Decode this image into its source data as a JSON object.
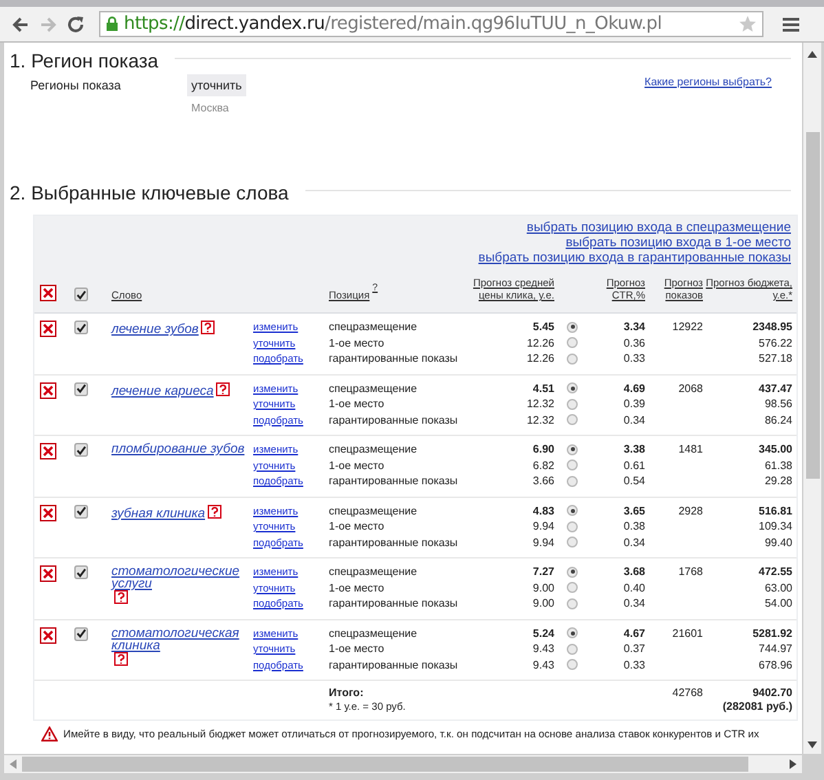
{
  "browser": {
    "url_scheme": "https://",
    "url_host": "direct.yandex.ru",
    "url_path": "/registered/main.qg96IuTUU_n_Okuw.pl"
  },
  "region_section": {
    "title": "1. Регион показа",
    "label": "Регионы показа",
    "button": "уточнить",
    "value": "Москва",
    "help_link": "Какие регионы выбрать?"
  },
  "keywords_section": {
    "title": "2. Выбранные ключевые слова",
    "bulk_links": [
      "выбрать позицию входа в спецразмещение",
      "выбрать позицию входа в 1-ое место",
      "выбрать позицию входа в гарантированные показы"
    ],
    "select_all_checked": true,
    "columns": {
      "word": "Слово",
      "position": "Позиция",
      "position_hint": "?",
      "price": "Прогноз средней цены клика, у.е.",
      "ctr": "Прогноз CTR,%",
      "shows": "Прогноз показов",
      "budget": "Прогноз бюджета, у.е.*"
    },
    "rows": [
      {
        "word": "лечение зубов",
        "help": true,
        "checked": true,
        "actions": [
          "изменить",
          "уточнить",
          "подобрать"
        ],
        "shows": "12922",
        "positions": [
          {
            "label": "спецразмещение",
            "price": "5.45",
            "ctr": "3.34",
            "budget": "2348.95",
            "selected": true
          },
          {
            "label": "1-ое место",
            "price": "12.26",
            "ctr": "0.36",
            "budget": "576.22",
            "selected": false
          },
          {
            "label": "гарантированные показы",
            "price": "12.26",
            "ctr": "0.33",
            "budget": "527.18",
            "selected": false
          }
        ]
      },
      {
        "word": "лечение кариеса",
        "help": true,
        "checked": true,
        "actions": [
          "изменить",
          "уточнить",
          "подобрать"
        ],
        "shows": "2068",
        "positions": [
          {
            "label": "спецразмещение",
            "price": "4.51",
            "ctr": "4.69",
            "budget": "437.47",
            "selected": true
          },
          {
            "label": "1-ое место",
            "price": "12.32",
            "ctr": "0.39",
            "budget": "98.56",
            "selected": false
          },
          {
            "label": "гарантированные показы",
            "price": "12.32",
            "ctr": "0.34",
            "budget": "86.24",
            "selected": false
          }
        ]
      },
      {
        "word": "пломбирование зубов",
        "help": false,
        "checked": true,
        "actions": [
          "изменить",
          "уточнить",
          "подобрать"
        ],
        "shows": "1481",
        "positions": [
          {
            "label": "спецразмещение",
            "price": "6.90",
            "ctr": "3.38",
            "budget": "345.00",
            "selected": true
          },
          {
            "label": "1-ое место",
            "price": "6.82",
            "ctr": "0.61",
            "budget": "61.38",
            "selected": false
          },
          {
            "label": "гарантированные показы",
            "price": "3.66",
            "ctr": "0.54",
            "budget": "29.28",
            "selected": false
          }
        ]
      },
      {
        "word": "зубная клиника",
        "help": true,
        "checked": true,
        "actions": [
          "изменить",
          "уточнить",
          "подобрать"
        ],
        "shows": "2928",
        "positions": [
          {
            "label": "спецразмещение",
            "price": "4.83",
            "ctr": "3.65",
            "budget": "516.81",
            "selected": true
          },
          {
            "label": "1-ое место",
            "price": "9.94",
            "ctr": "0.38",
            "budget": "109.34",
            "selected": false
          },
          {
            "label": "гарантированные показы",
            "price": "9.94",
            "ctr": "0.34",
            "budget": "99.40",
            "selected": false
          }
        ]
      },
      {
        "word": "стоматологические услуги",
        "help": true,
        "checked": true,
        "actions": [
          "изменить",
          "уточнить",
          "подобрать"
        ],
        "shows": "1768",
        "positions": [
          {
            "label": "спецразмещение",
            "price": "7.27",
            "ctr": "3.68",
            "budget": "472.55",
            "selected": true
          },
          {
            "label": "1-ое место",
            "price": "9.00",
            "ctr": "0.40",
            "budget": "63.00",
            "selected": false
          },
          {
            "label": "гарантированные показы",
            "price": "9.00",
            "ctr": "0.34",
            "budget": "54.00",
            "selected": false
          }
        ]
      },
      {
        "word": "стоматологическая клиника",
        "help": true,
        "checked": true,
        "actions": [
          "изменить",
          "уточнить",
          "подобрать"
        ],
        "shows": "21601",
        "positions": [
          {
            "label": "спецразмещение",
            "price": "5.24",
            "ctr": "4.67",
            "budget": "5281.92",
            "selected": true
          },
          {
            "label": "1-ое место",
            "price": "9.43",
            "ctr": "0.37",
            "budget": "744.97",
            "selected": false
          },
          {
            "label": "гарантированные показы",
            "price": "9.43",
            "ctr": "0.33",
            "budget": "678.96",
            "selected": false
          }
        ]
      }
    ],
    "total": {
      "label": "Итого:",
      "note": "* 1 у.е. = 30 руб.",
      "shows": "42768",
      "budget": "9402.70",
      "budget_rub": "(282081 руб.)"
    },
    "warning": "Имейте в виду, что реальный бюджет может отличаться от прогнозируемого, т.к. он подсчитан на основе анализа ставок конкурентов и CTR их"
  }
}
